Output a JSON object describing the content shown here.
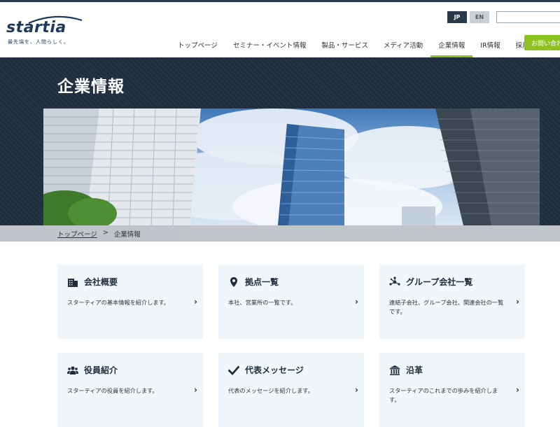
{
  "header": {
    "logo_text": "startia",
    "logo_tagline": "最先端を、人間らしく。",
    "lang_jp": "JP",
    "lang_en": "EN",
    "search_value": "",
    "nav": [
      "トップページ",
      "セミナー・イベント情報",
      "製品・サービス",
      "メディア活動",
      "企業情報",
      "IR情報",
      "採用情報"
    ],
    "active_nav": "企業情報",
    "contact_label": "お問い合わせ",
    "accent_color": "#8dc21f"
  },
  "page": {
    "title": "企業情報"
  },
  "breadcrumb": {
    "home": "トップページ",
    "separator": ">",
    "current": "企業情報"
  },
  "cards": [
    {
      "title": "会社概要",
      "icon": "building-icon",
      "desc": "スターティアの基本情報を紹介します。"
    },
    {
      "title": "拠点一覧",
      "icon": "map-pin-icon",
      "desc": "本社、営業所の一覧です。"
    },
    {
      "title": "グループ会社一覧",
      "icon": "network-icon",
      "desc": "連結子会社、グループ会社、関連会社の一覧です。"
    },
    {
      "title": "役員紹介",
      "icon": "people-icon",
      "desc": "スターティアの役員を紹介します。"
    },
    {
      "title": "代表メッセージ",
      "icon": "check-icon",
      "desc": "代表のメッセージを紹介します。"
    },
    {
      "title": "沿革",
      "icon": "institution-icon",
      "desc": "スターティアのこれまでの歩みを紹介します。"
    }
  ]
}
